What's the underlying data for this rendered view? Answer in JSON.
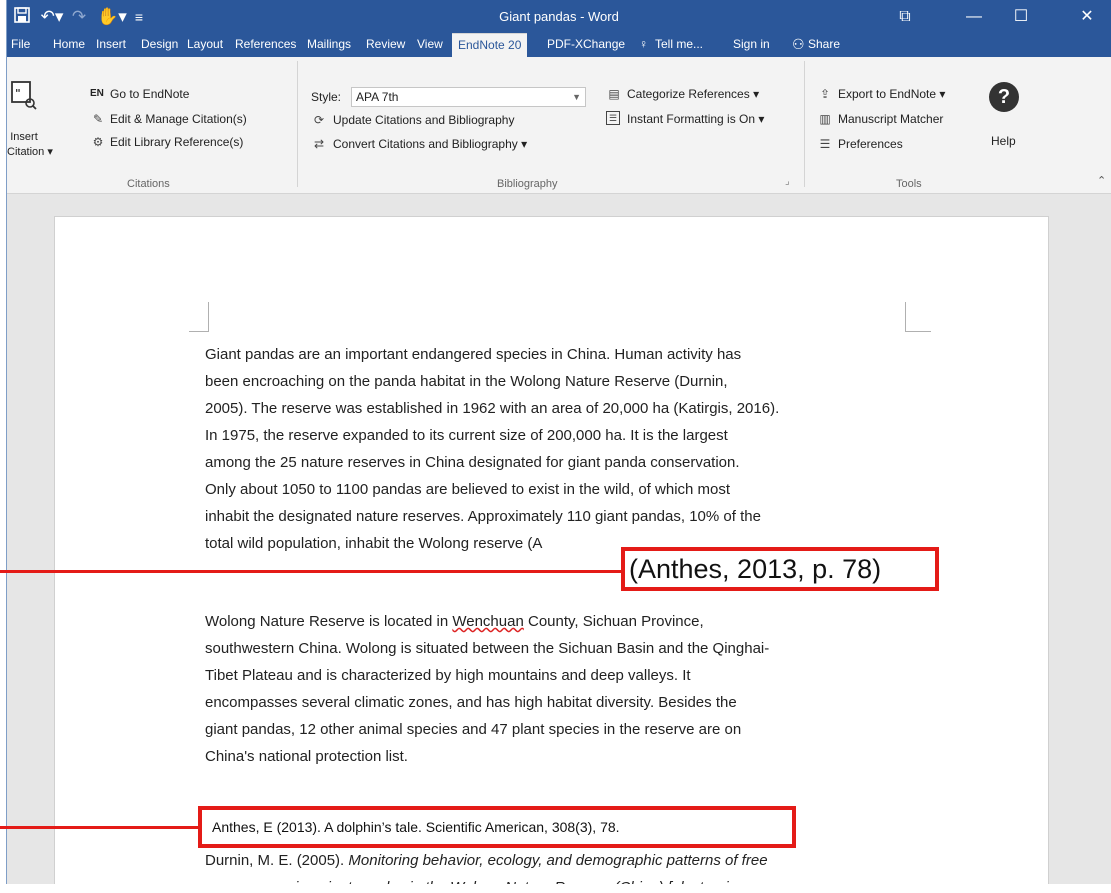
{
  "window": {
    "title": "Giant pandas - Word",
    "controls": {
      "restore": "⧉",
      "minimize": "—",
      "maximize": "☐",
      "close": "✕"
    }
  },
  "tabs": [
    {
      "label": "File"
    },
    {
      "label": "Home"
    },
    {
      "label": "Insert"
    },
    {
      "label": "Design"
    },
    {
      "label": "Layout"
    },
    {
      "label": "References"
    },
    {
      "label": "Mailings"
    },
    {
      "label": "Review"
    },
    {
      "label": "View"
    },
    {
      "label": "EndNote 20"
    },
    {
      "label": "PDF-XChange"
    },
    {
      "label": "Tell me..."
    },
    {
      "label": "Sign in"
    },
    {
      "label": "Share"
    }
  ],
  "ribbon": {
    "citations": {
      "insert_citation": "Insert",
      "insert_citation_2": "Citation",
      "go_to_endnote": "Go to EndNote",
      "endnote_badge": "EN",
      "edit_manage": "Edit & Manage Citation(s)",
      "edit_library": "Edit Library Reference(s)",
      "group_label": "Citations"
    },
    "bibliography": {
      "style_label": "Style:",
      "style_value": "APA 7th",
      "update": "Update Citations and Bibliography",
      "convert": "Convert Citations and Bibliography",
      "categorize": "Categorize References",
      "instant": "Instant Formatting is On",
      "group_label": "Bibliography"
    },
    "tools": {
      "export": "Export to EndNote",
      "manuscript": "Manuscript Matcher",
      "preferences": "Preferences",
      "help": "Help",
      "help_glyph": "?",
      "group_label": "Tools"
    }
  },
  "document": {
    "para1": [
      "Giant pandas are an important endangered species in China.    Human activity has",
      "been encroaching on the panda habitat in the Wolong Nature Reserve (Durnin,",
      "2005). The reserve was established in 1962 with an area of 20,000 ha (Katirgis, 2016).",
      "In 1975, the reserve expanded to its current size of 200,000 ha. It is the largest",
      "among the 25 nature reserves in China designated for giant panda conservation.",
      "Only about 1050 to 1100 pandas are believed to exist in the wild, of which most",
      "inhabit the designated nature reserves. Approximately 110 giant pandas, 10% of the",
      "total wild population, inhabit the Wolong reserve (A"
    ],
    "para2": {
      "l1_a": "Wolong Nature Reserve is located in ",
      "l1_b": "Wenchuan",
      "l1_c": " County, Sichuan Province,",
      "lines": [
        "southwestern China. Wolong is situated between the Sichuan Basin and the Qinghai-",
        "Tibet Plateau and is characterized by high mountains and deep valleys.    It",
        "encompasses several climatic zones, and has high habitat diversity.    Besides the",
        "giant pandas, 12 other animal species and 47 plant species in the reserve are on",
        "China's national protection list."
      ]
    },
    "ref2_a": "Durnin, M. E. (2005). ",
    "ref2_b": "Monitoring behavior, ecology, and demographic patterns of free",
    "ref2_c": "ranging giant pandas in the Wolong Nature Reserve (China) [electronic"
  },
  "annotations": {
    "citation_callout": "(Anthes, 2013, p. 78)",
    "reference_callout": "Anthes, E (2013). A dolphin’s tale. Scientific American, 308(3), 78."
  }
}
